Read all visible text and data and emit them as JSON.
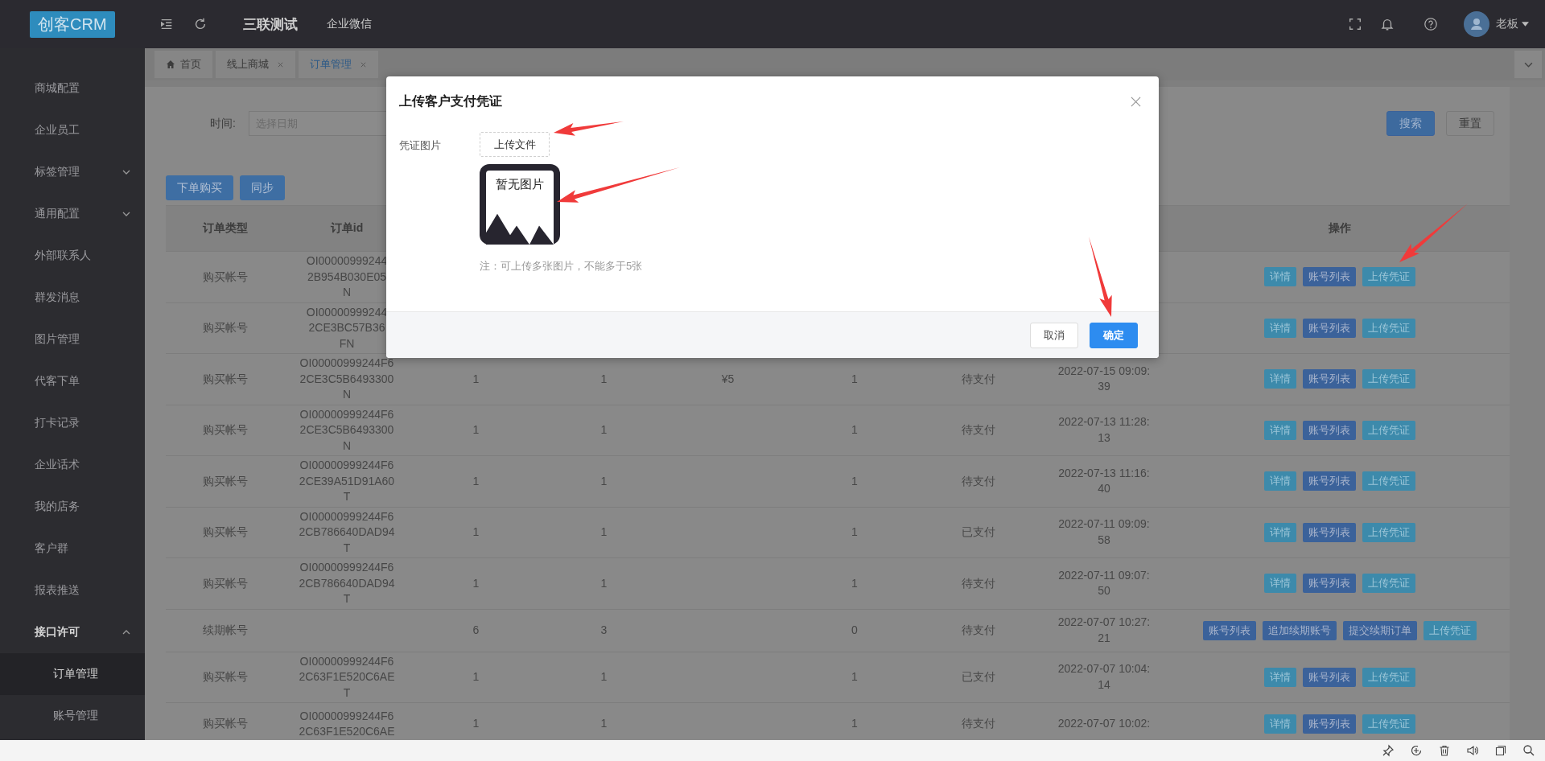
{
  "header": {
    "logo": "创客CRM",
    "company": "三联测试",
    "app": "企业微信",
    "user": "老板"
  },
  "sidebar": {
    "items": [
      {
        "label": "商城配置",
        "kind": "link",
        "selected": false
      },
      {
        "label": "企业员工",
        "kind": "link",
        "selected": false
      },
      {
        "label": "标签管理",
        "kind": "group",
        "expanded": false,
        "selected": false
      },
      {
        "label": "通用配置",
        "kind": "group",
        "expanded": false,
        "selected": false
      },
      {
        "label": "外部联系人",
        "kind": "link",
        "selected": false
      },
      {
        "label": "群发消息",
        "kind": "link",
        "selected": false
      },
      {
        "label": "图片管理",
        "kind": "link",
        "selected": false
      },
      {
        "label": "代客下单",
        "kind": "link",
        "selected": false
      },
      {
        "label": "打卡记录",
        "kind": "link",
        "selected": false
      },
      {
        "label": "企业话术",
        "kind": "link",
        "selected": false
      },
      {
        "label": "我的店务",
        "kind": "link",
        "selected": false
      },
      {
        "label": "客户群",
        "kind": "link",
        "selected": false
      },
      {
        "label": "报表推送",
        "kind": "link",
        "selected": false
      },
      {
        "label": "接口许可",
        "kind": "group",
        "expanded": true,
        "selected": false,
        "children": [
          {
            "label": "订单管理",
            "selected": true
          },
          {
            "label": "账号管理",
            "selected": false
          }
        ]
      }
    ]
  },
  "tabs": [
    {
      "label": "首页",
      "kind": "home",
      "closable": false,
      "selected": false
    },
    {
      "label": "线上商城",
      "kind": "page",
      "closable": true,
      "selected": false
    },
    {
      "label": "订单管理",
      "kind": "page",
      "closable": true,
      "selected": true
    }
  ],
  "filter": {
    "label": "时间:",
    "date_placeholder": "选择日期",
    "buttons": [
      {
        "label": "搜索",
        "kind": "primary"
      },
      {
        "label": "重置",
        "kind": "default"
      }
    ]
  },
  "toolbar": [
    "下单购买",
    "同步"
  ],
  "table": {
    "columns": [
      "订单类型",
      "订单id"
    ],
    "actions_column": "操作",
    "rows": [
      {
        "type": "购买帐号",
        "id_lines": [
          "OI00000999244",
          "2B954B030E05",
          "N"
        ],
        "actions": [
          {
            "label": "详情",
            "kind": "info"
          },
          {
            "label": "账号列表",
            "kind": "primary"
          },
          {
            "label": "上传凭证",
            "kind": "info"
          }
        ]
      },
      {
        "type": "购买帐号",
        "id_lines": [
          "OI00000999244",
          "2CE3BC57B36",
          "FN"
        ],
        "actions": [
          {
            "label": "详情",
            "kind": "info"
          },
          {
            "label": "账号列表",
            "kind": "primary"
          },
          {
            "label": "上传凭证",
            "kind": "info"
          }
        ]
      },
      {
        "type": "购买帐号",
        "id_lines": [
          "OI00000999244F6",
          "2CE3C5B6493300",
          "N"
        ],
        "column_3": "1",
        "column_4": "1",
        "column_5": "¥5",
        "column_6": "1",
        "column_7": "待支付",
        "column_8": "2022-07-15 09:09:39",
        "actions": [
          {
            "label": "详情",
            "kind": "info"
          },
          {
            "label": "账号列表",
            "kind": "primary"
          },
          {
            "label": "上传凭证",
            "kind": "info"
          }
        ]
      },
      {
        "type": "购买帐号",
        "id_lines": [
          "OI00000999244F6",
          "2CE3C5B6493300",
          "N"
        ],
        "column_3": "1",
        "column_4": "1",
        "column_6": "1",
        "column_7": "待支付",
        "column_8": "2022-07-13 11:28:13",
        "actions": [
          {
            "label": "详情",
            "kind": "info"
          },
          {
            "label": "账号列表",
            "kind": "primary"
          },
          {
            "label": "上传凭证",
            "kind": "info"
          }
        ]
      },
      {
        "type": "购买帐号",
        "id_lines": [
          "OI00000999244F6",
          "2CE39A51D91A60",
          "T"
        ],
        "column_3": "1",
        "column_4": "1",
        "column_6": "1",
        "column_7": "待支付",
        "column_8": "2022-07-13 11:16:40",
        "actions": [
          {
            "label": "详情",
            "kind": "info"
          },
          {
            "label": "账号列表",
            "kind": "primary"
          },
          {
            "label": "上传凭证",
            "kind": "info"
          }
        ]
      },
      {
        "type": "购买帐号",
        "id_lines": [
          "OI00000999244F6",
          "2CB786640DAD94",
          "T"
        ],
        "column_3": "1",
        "column_4": "1",
        "column_6": "1",
        "column_7": "已支付",
        "column_8": "2022-07-11 09:09:58",
        "actions": [
          {
            "label": "详情",
            "kind": "info"
          },
          {
            "label": "账号列表",
            "kind": "primary"
          },
          {
            "label": "上传凭证",
            "kind": "info"
          }
        ]
      },
      {
        "type": "购买帐号",
        "id_lines": [
          "OI00000999244F6",
          "2CB786640DAD94",
          "T"
        ],
        "column_3": "1",
        "column_4": "1",
        "column_6": "1",
        "column_7": "待支付",
        "column_8": "2022-07-11 09:07:50",
        "actions": [
          {
            "label": "详情",
            "kind": "info"
          },
          {
            "label": "账号列表",
            "kind": "primary"
          },
          {
            "label": "上传凭证",
            "kind": "info"
          }
        ]
      },
      {
        "type": "续期帐号",
        "column_3": "6",
        "column_4": "3",
        "column_6": "0",
        "column_7": "待支付",
        "column_8": "2022-07-07 10:27:21",
        "actions": [
          {
            "label": "账号列表",
            "kind": "primary"
          },
          {
            "label": "追加续期账号",
            "kind": "primary"
          },
          {
            "label": "提交续期订单",
            "kind": "primary"
          },
          {
            "label": "上传凭证",
            "kind": "info"
          }
        ]
      },
      {
        "type": "购买帐号",
        "id_lines": [
          "OI00000999244F6",
          "2C63F1E520C6AE",
          "T"
        ],
        "column_3": "1",
        "column_4": "1",
        "column_6": "1",
        "column_7": "已支付",
        "column_8": "2022-07-07 10:04:14",
        "actions": [
          {
            "label": "详情",
            "kind": "info"
          },
          {
            "label": "账号列表",
            "kind": "primary"
          },
          {
            "label": "上传凭证",
            "kind": "info"
          }
        ]
      },
      {
        "type": "购买帐号",
        "id_lines": [
          "OI00000999244F6",
          "2C63F1E520C6AE"
        ],
        "column_3": "1",
        "column_4": "1",
        "column_6": "1",
        "column_7": "待支付",
        "column_8": "2022-07-07 10:02:",
        "actions": [
          {
            "label": "详情",
            "kind": "info"
          },
          {
            "label": "账号列表",
            "kind": "primary"
          },
          {
            "label": "上传凭证",
            "kind": "info"
          }
        ]
      }
    ]
  },
  "modal": {
    "title": "上传客户支付凭证",
    "field_label": "凭证图片",
    "upload_button": "上传文件",
    "empty_image_text": "暂无图片",
    "note": "注：可上传多张图片，不能多于5张",
    "buttons": [
      {
        "label": "取消",
        "kind": "default"
      },
      {
        "label": "确定",
        "kind": "primary"
      }
    ]
  }
}
